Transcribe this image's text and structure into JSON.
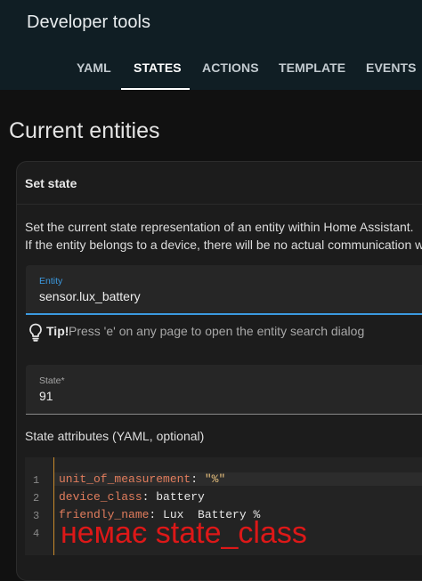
{
  "header": {
    "title": "Developer tools",
    "tabs": [
      {
        "label": "YAML",
        "active": false
      },
      {
        "label": "STATES",
        "active": true
      },
      {
        "label": "ACTIONS",
        "active": false
      },
      {
        "label": "TEMPLATE",
        "active": false
      },
      {
        "label": "EVENTS",
        "active": false
      }
    ]
  },
  "page": {
    "title": "Current entities"
  },
  "set_state": {
    "title": "Set state",
    "description_line1": "Set the current state representation of an entity within Home Assistant.",
    "description_line2": "If the entity belongs to a device, there will be no actual communication with the device.",
    "entity_label": "Entity",
    "entity_value": "sensor.lux_battery",
    "tip_label": "Tip!",
    "tip_text": "Press 'e' on any page to open the entity search dialog",
    "state_label": "State*",
    "state_value": "91",
    "attributes_label": "State attributes (YAML, optional)",
    "line_numbers": [
      "1",
      "2",
      "3",
      "4"
    ],
    "attributes": [
      {
        "key": "unit_of_measurement",
        "sep": ": ",
        "value": "\"%\""
      },
      {
        "key": "device_class",
        "sep": ": ",
        "value": "battery"
      },
      {
        "key": "friendly_name",
        "sep": ": ",
        "value": "Lux  Battery %"
      }
    ]
  },
  "annotation": "немає state_class",
  "colors": {
    "header_bg": "#101e24",
    "accent": "#3b99e0",
    "yaml_key": "#e27d5d",
    "yaml_string": "#e8c07d",
    "annotation": "#dd1818"
  }
}
